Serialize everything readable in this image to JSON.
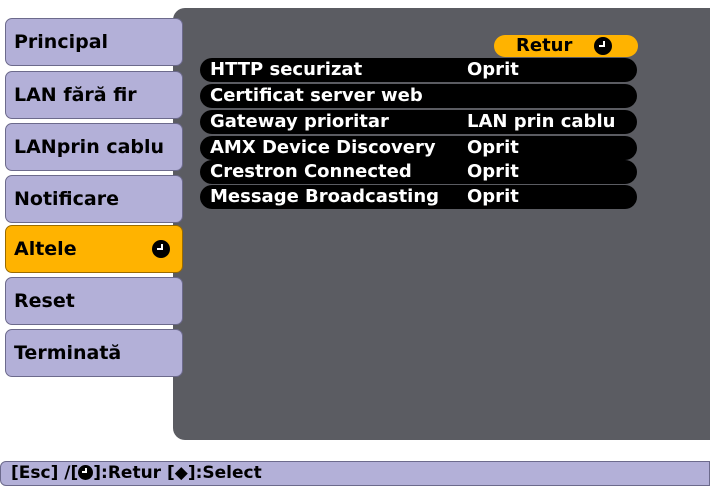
{
  "menu": {
    "items": [
      {
        "label": "Principal"
      },
      {
        "label": "LAN fără fir"
      },
      {
        "label": "LANprin cablu"
      },
      {
        "label": "Notificare"
      },
      {
        "label": "Altele"
      },
      {
        "label": "Reset"
      },
      {
        "label": "Terminată"
      }
    ],
    "selected": "Altele"
  },
  "panel": {
    "return_label": "Retur",
    "rows": [
      {
        "label": "HTTP securizat",
        "value": "Oprit"
      },
      {
        "label": "Certificat server web",
        "value": ""
      },
      {
        "label": "Gateway prioritar",
        "value": "LAN prin cablu"
      },
      {
        "label": "AMX Device Discovery",
        "value": "Oprit"
      },
      {
        "label": "Crestron Connected",
        "value": "Oprit"
      },
      {
        "label": "Message Broadcasting",
        "value": "Oprit"
      }
    ]
  },
  "help": {
    "esc": "[Esc] /[",
    "ret": "]:Retur  [",
    "updown": "◆",
    "select": "]:Select"
  },
  "colors": {
    "menu_bg": "#b3b0d8",
    "selected_bg": "#ffb300",
    "panel_bg": "#5b5c62",
    "row_bg": "#000000"
  }
}
